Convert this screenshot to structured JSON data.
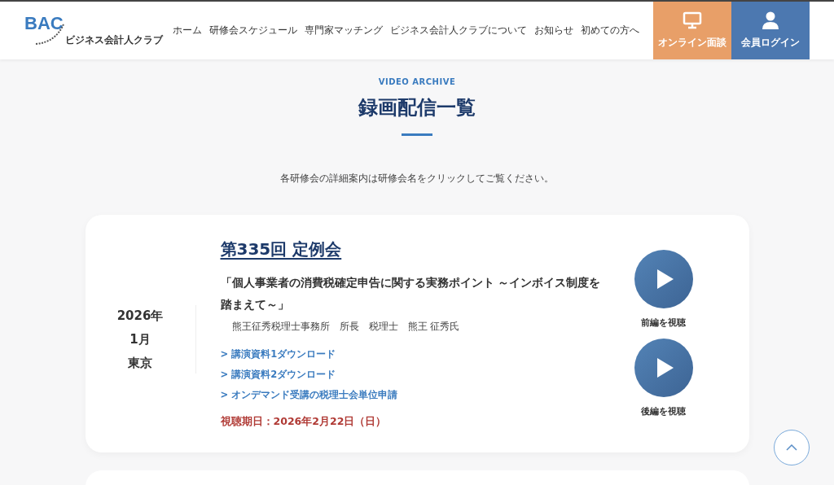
{
  "header": {
    "logo": {
      "mark": "BAC",
      "name": "ビジネス会計人クラブ"
    },
    "nav": [
      "ホーム",
      "研修会スケジュール",
      "専門家マッチング",
      "ビジネス会計人クラブについて",
      "お知らせ",
      "初めての方へ"
    ],
    "actions": [
      {
        "kind": "online",
        "label": "オンライン面談",
        "color": "#e89f68"
      },
      {
        "kind": "login",
        "label": "会員ログイン",
        "color": "#4c78b0"
      }
    ]
  },
  "section": {
    "eyebrow": "VIDEO ARCHIVE",
    "title": "録画配信一覧",
    "note": "各研修会の詳細案内は研修会名をクリックしてご覧ください。"
  },
  "sessions": [
    {
      "year": "2026年",
      "month": "1月",
      "place": "東京",
      "title": "第335回 定例会",
      "theme": "「個人事業者の消費税確定申告に関する実務ポイント ～インボイス制度を踏まえて～」",
      "speaker": "熊王征秀税理士事務所　所長　税理士　熊王 征秀氏",
      "links": [
        "> 講演資料1ダウンロード",
        "> 講演資料2ダウンロード",
        "> オンデマンド受講の税理士会単位申請"
      ],
      "deadline": "視聴期日：2026年2月22日（日）",
      "videos": [
        "前編を視聴",
        "後編を視聴"
      ]
    }
  ]
}
